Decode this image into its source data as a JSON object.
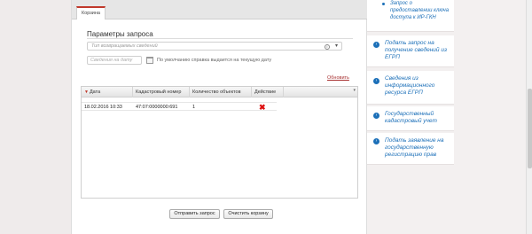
{
  "tabs": [
    "Корзина"
  ],
  "request_params": {
    "title": "Параметры запроса",
    "type_placeholder": "Тип возвращаемых сведений",
    "date_placeholder": "Сведения на дату",
    "date_hint": "По умолчанию справка выдается на текущую дату",
    "refresh_link": "Обновить"
  },
  "grid": {
    "columns": [
      "Дата",
      "Кадастровый номер",
      "Количество объектов",
      "Действие"
    ],
    "rows": [
      {
        "date": "18.02.2016 10:33",
        "cadastral_number": "47:07:0000000:691",
        "count": "1"
      }
    ]
  },
  "buttons": {
    "send": "Отправить запрос",
    "clear": "Очистить корзину"
  },
  "sidebar": {
    "top_item": "Запрос о предоставлении ключа доступа к ИР-ГКН",
    "items": [
      "Подать запрос на получение сведений из ЕГРП",
      "Сведения из информационного ресурса ЕГРП",
      "Государственный кадастровый учет",
      "Подать заявление на государственную регистрацию прав"
    ]
  },
  "colors": {
    "accent_red": "#c0392b",
    "link_blue": "#1b6fb8",
    "delete_red": "#dd1111"
  }
}
